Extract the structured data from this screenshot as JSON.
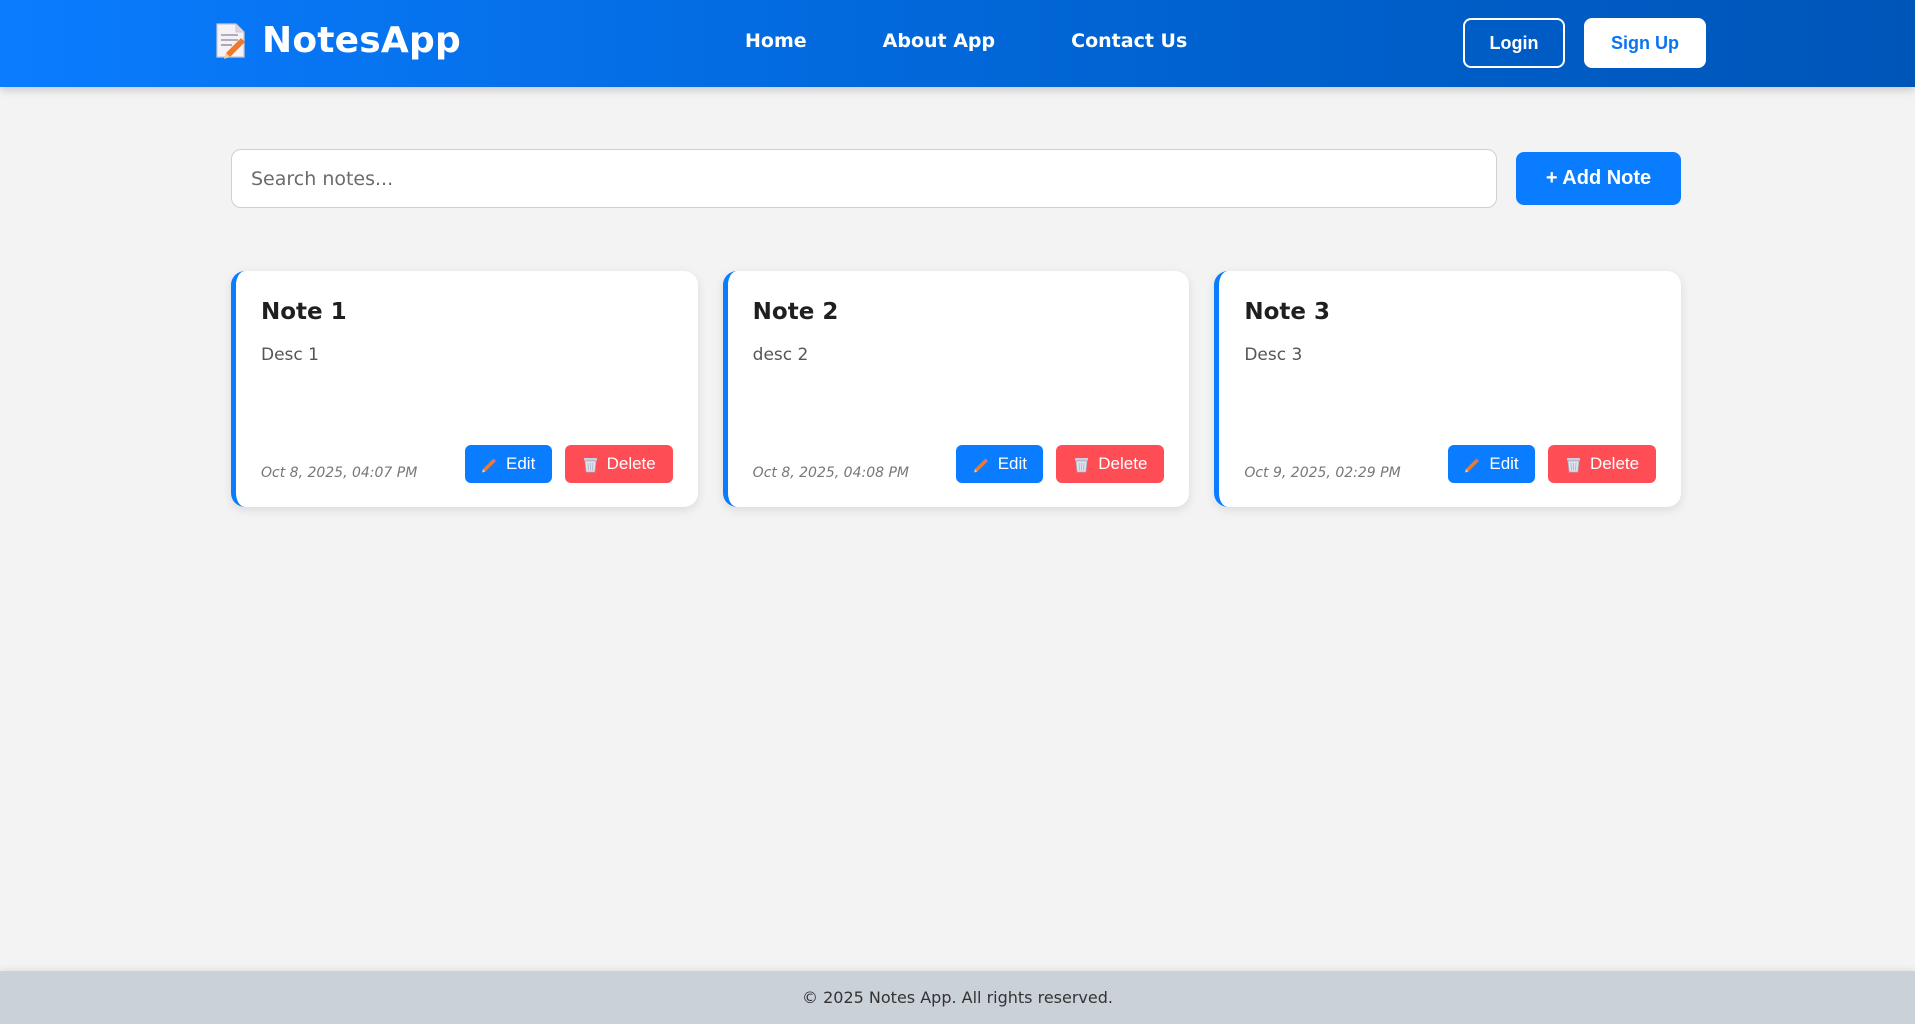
{
  "brand": {
    "title": "NotesApp",
    "icon": "memo-icon"
  },
  "nav": {
    "links": [
      {
        "label": "Home"
      },
      {
        "label": "About App"
      },
      {
        "label": "Contact Us"
      }
    ]
  },
  "auth": {
    "login_label": "Login",
    "signup_label": "Sign Up"
  },
  "search": {
    "placeholder": "Search notes...",
    "value": ""
  },
  "actions": {
    "add_note_label": "+ Add Note"
  },
  "notes": [
    {
      "title": "Note 1",
      "desc": "Desc 1",
      "date": "Oct 8, 2025, 04:07 PM",
      "edit_label": "Edit",
      "delete_label": "Delete"
    },
    {
      "title": "Note 2",
      "desc": "desc 2",
      "date": "Oct 8, 2025, 04:08 PM",
      "edit_label": "Edit",
      "delete_label": "Delete"
    },
    {
      "title": "Note 3",
      "desc": "Desc 3",
      "date": "Oct 9, 2025, 02:29 PM",
      "edit_label": "Edit",
      "delete_label": "Delete"
    }
  ],
  "footer": {
    "text": "© 2025 Notes App. All rights reserved."
  },
  "colors": {
    "primary": "#0a7cff",
    "danger": "#ff4d55",
    "background": "#f3f3f3",
    "footer": "#cbd1d9"
  },
  "icons": {
    "edit": "pencil-icon",
    "delete": "wastebasket-icon"
  }
}
